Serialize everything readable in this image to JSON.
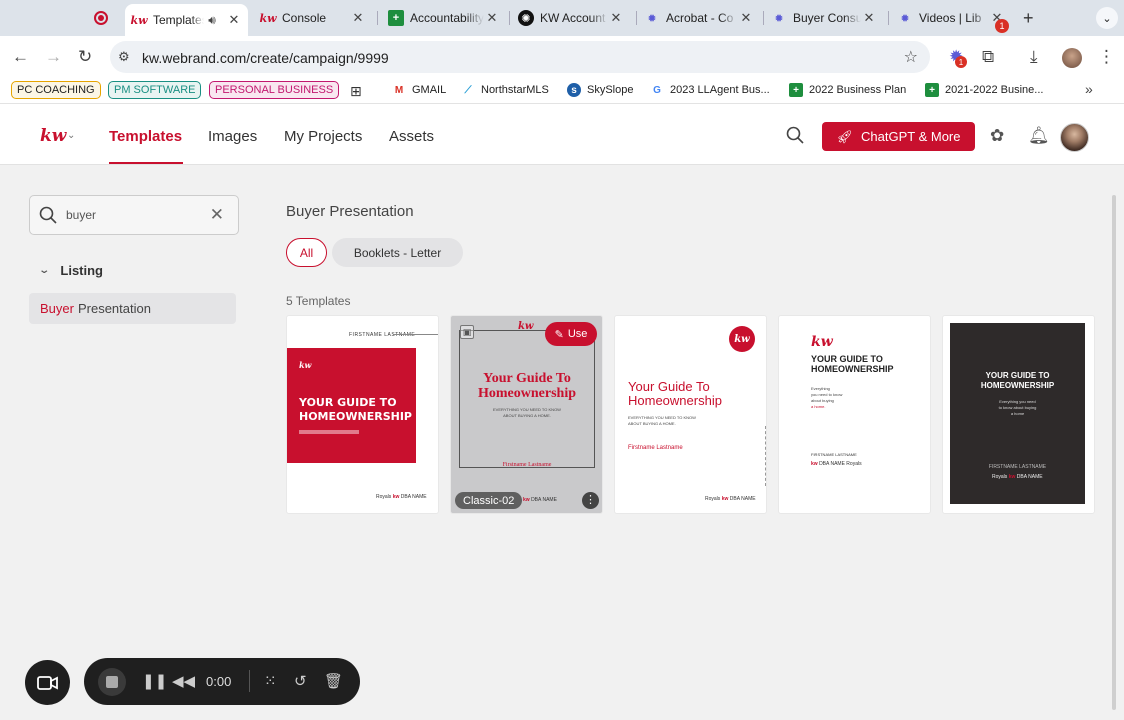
{
  "browser": {
    "tabs": [
      {
        "label": "Templates",
        "favicon": "kw-icon",
        "active": true,
        "audio": true
      },
      {
        "label": "Console",
        "favicon": "kw-icon"
      },
      {
        "label": "Accountability",
        "favicon": "sheets-icon"
      },
      {
        "label": "KW Account",
        "favicon": "openai-icon"
      },
      {
        "label": "Acrobat - Co",
        "favicon": "gear-icon"
      },
      {
        "label": "Buyer Consult",
        "favicon": "gear-icon"
      },
      {
        "label": "Videos | Lib",
        "favicon": "gear-icon"
      }
    ],
    "url": "kw.webrand.com/create/campaign/9999",
    "extension_badge": "1",
    "bookmarks": {
      "pills": [
        {
          "label": "PC COACHING",
          "color": "#e6a400"
        },
        {
          "label": "PM SOFTWARE",
          "color": "#1a8f83"
        },
        {
          "label": "PERSONAL BUSINESS",
          "color": "#c2186f"
        }
      ],
      "links": [
        {
          "label": "GMAIL",
          "icon": "gmail-icon"
        },
        {
          "label": "NorthstarMLS",
          "icon": "northstar-icon"
        },
        {
          "label": "SkySlope",
          "icon": "skyslope-icon"
        },
        {
          "label": "2023 LLAgent Bus...",
          "icon": "google-icon"
        },
        {
          "label": "2022 Business Plan",
          "icon": "sheets-icon"
        },
        {
          "label": "2021-2022 Busine...",
          "icon": "sheets-icon"
        }
      ]
    }
  },
  "app": {
    "logo": "kw",
    "nav": [
      "Templates",
      "Images",
      "My Projects",
      "Assets"
    ],
    "cta_label": "ChatGPT & More",
    "notification_badge": "1",
    "accent": "#c8102e"
  },
  "sidebar": {
    "search_value": "buyer",
    "section": "Listing",
    "item_highlight": "Buyer",
    "item_rest": "Presentation"
  },
  "main": {
    "title": "Buyer Presentation",
    "filters": [
      "All",
      "Booklets - Letter"
    ],
    "count_label": "5 Templates",
    "cards": [
      {
        "top_name": "FIRSTNAME LASTNAME",
        "logo": "kw",
        "title_line1": "YOUR GUIDE TO",
        "title_line2": "HOMEOWNERSHIP",
        "footer": "Royals",
        "footer_kw": "kw",
        "footer_brand": "DBA NAME"
      },
      {
        "logo": "kw",
        "title_line1": "Your Guide To",
        "title_line2": "Homeownership",
        "subtitle_line1": "EVERYTHING YOU NEED TO KNOW",
        "subtitle_line2": "ABOUT BUYING A HOME.",
        "name": "Firstname Lastname",
        "use_label": "Use",
        "label": "Classic-02",
        "footer_kw": "kw",
        "footer_brand": "DBA NAME"
      },
      {
        "logo": "kw",
        "title_line1": "Your Guide To",
        "title_line2": "Homeownership",
        "subtitle_line1": "EVERYTHING YOU NEED TO KNOW",
        "subtitle_line2": "ABOUT BUYING A HOME.",
        "name": "Firstname Lastname",
        "footer": "Royals",
        "footer_kw": "kw",
        "footer_brand": "DBA NAME"
      },
      {
        "logo": "kw",
        "title_line1": "YOUR GUIDE TO",
        "title_line2": "HOMEOWNERSHIP",
        "sub_lines": [
          "Everything",
          "you need to know",
          "about buying",
          "a home."
        ],
        "name": "FIRSTNAME LASTNAME",
        "footer": "Royals",
        "footer_kw": "kw",
        "footer_brand": "DBA NAME"
      },
      {
        "title_line1": "YOUR GUIDE TO",
        "title_line2": "HOMEOWNERSHIP",
        "sub_lines": [
          "Everything you need",
          "to know about buying",
          "a home"
        ],
        "name": "FIRSTNAME LASTNAME",
        "footer": "Royals",
        "footer_kw": "kw",
        "footer_brand": "DBA NAME"
      }
    ]
  },
  "recorder": {
    "time": "0:00"
  }
}
